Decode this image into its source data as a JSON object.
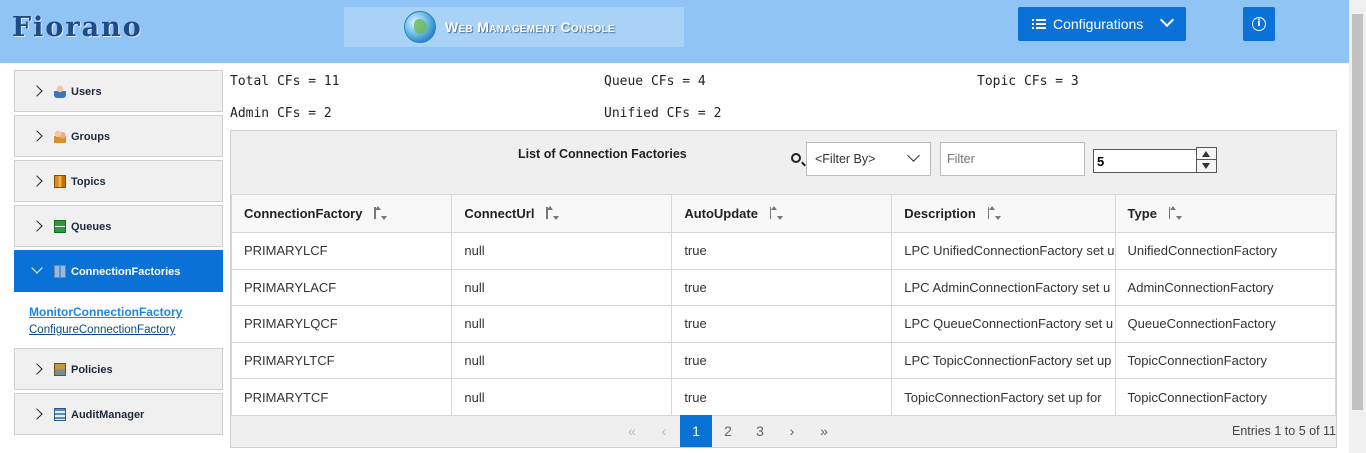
{
  "header": {
    "logo": "Fiorano",
    "console_title": "Web Management Console",
    "config_label": "Configurations",
    "info_icon": "i"
  },
  "sidebar": {
    "items": [
      {
        "label": "Users",
        "icon": "user-icon"
      },
      {
        "label": "Groups",
        "icon": "groups-icon"
      },
      {
        "label": "Topics",
        "icon": "topics-icon"
      },
      {
        "label": "Queues",
        "icon": "queues-icon"
      },
      {
        "label": "ConnectionFactories",
        "icon": "connection-factories-icon",
        "active": true
      },
      {
        "label": "Policies",
        "icon": "policies-icon"
      },
      {
        "label": "AuditManager",
        "icon": "audit-manager-icon"
      }
    ],
    "submenu": {
      "monitor": "MonitorConnectionFactory",
      "configure": "ConfigureConnectionFactory"
    }
  },
  "stats": {
    "total": "Total CFs = 11",
    "queue": "Queue CFs = 4",
    "topic": "Topic CFs = 3",
    "admin": "Admin CFs = 2",
    "unified": "Unified CFs = 2"
  },
  "panel": {
    "title": "List of Connection Factories",
    "filter_select": "<Filter By>",
    "filter_placeholder": "Filter",
    "page_size": "5"
  },
  "table": {
    "columns": [
      "ConnectionFactory",
      "ConnectUrl",
      "AutoUpdate",
      "Description",
      "Type"
    ],
    "rows": [
      [
        "PRIMARYLCF",
        "null",
        "true",
        "LPC UnifiedConnectionFactory set u",
        "UnifiedConnectionFactory"
      ],
      [
        "PRIMARYLACF",
        "null",
        "true",
        "LPC AdminConnectionFactory set u",
        "AdminConnectionFactory"
      ],
      [
        "PRIMARYLQCF",
        "null",
        "true",
        "LPC QueueConnectionFactory set u",
        "QueueConnectionFactory"
      ],
      [
        "PRIMARYLTCF",
        "null",
        "true",
        "LPC TopicConnectionFactory set up",
        "TopicConnectionFactory"
      ],
      [
        "PRIMARYTCF",
        "null",
        "true",
        "TopicConnectionFactory set up for",
        "TopicConnectionFactory"
      ]
    ]
  },
  "pager": {
    "first": "«",
    "prev": "‹",
    "pages": [
      "1",
      "2",
      "3"
    ],
    "next": "›",
    "last": "»",
    "entries": "Entries 1 to 5 of 11"
  }
}
